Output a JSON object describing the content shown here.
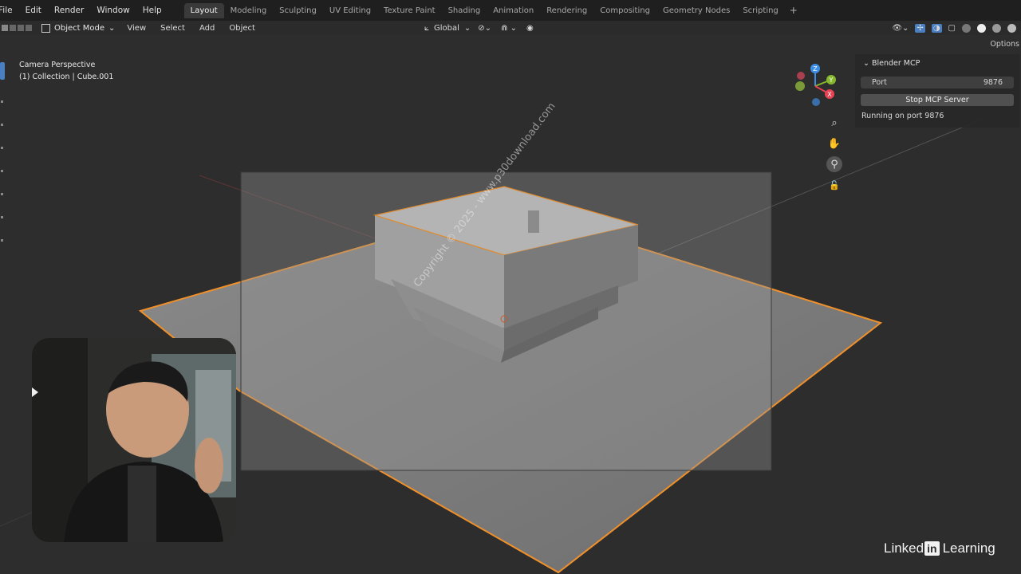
{
  "topbar": {
    "menus": [
      "File",
      "Edit",
      "Render",
      "Window",
      "Help"
    ],
    "workspaces": [
      "Layout",
      "Modeling",
      "Sculpting",
      "UV Editing",
      "Texture Paint",
      "Shading",
      "Animation",
      "Rendering",
      "Compositing",
      "Geometry Nodes",
      "Scripting"
    ],
    "active_workspace": "Layout",
    "add_tab": "+"
  },
  "header": {
    "mode": "Object Mode",
    "menus": [
      "View",
      "Select",
      "Add",
      "Object"
    ],
    "orientation": "Global",
    "options_label": "Options"
  },
  "viewport": {
    "view_name": "Camera Perspective",
    "collection_info": "(1) Collection | Cube.001"
  },
  "gizmo": {
    "axes": [
      "Z",
      "Y",
      "X"
    ],
    "colors": {
      "x": "#e84352",
      "y": "#86b72c",
      "z": "#3b8ee6"
    }
  },
  "nav_buttons": [
    "zoom-icon",
    "hand-pan-icon",
    "camera-view-icon",
    "lock-icon"
  ],
  "blender_mcp": {
    "title": "Blender MCP",
    "port_label": "Port",
    "port_value": "9876",
    "stop_button": "Stop MCP Server",
    "status": "Running on port 9876"
  },
  "watermark": "Copyright © 2025 - www.p30download.com",
  "brand": {
    "prefix": "Linked",
    "in": "in",
    "suffix": "Learning"
  },
  "colors": {
    "selection_outline": "#f0902a",
    "topbar": "#1f1f1f",
    "viewport": "#2d2d2d",
    "active_tab": "#3a3a3a"
  }
}
